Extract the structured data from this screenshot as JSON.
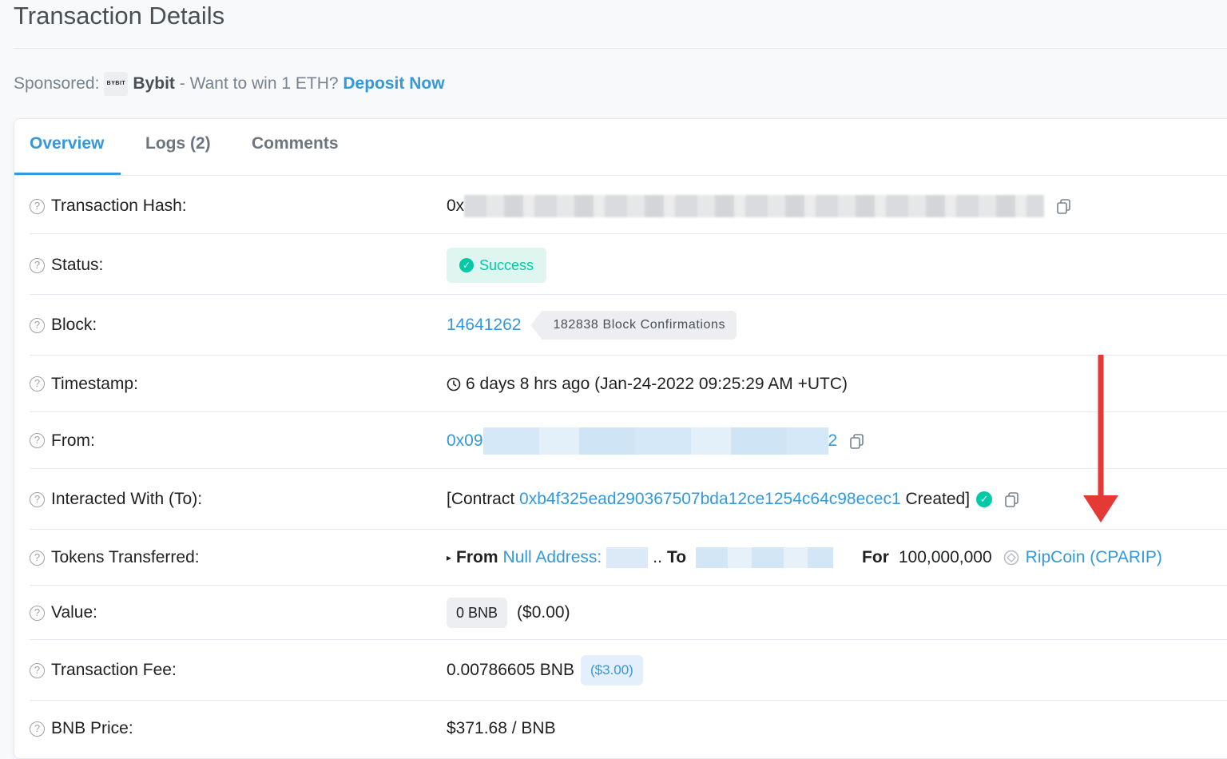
{
  "page": {
    "title": "Transaction Details"
  },
  "sponsored": {
    "label": "Sponsored:",
    "logo_text": "BYBIT",
    "brand": "Bybit",
    "text": " - Want to win 1 ETH? ",
    "link": "Deposit Now"
  },
  "tabs": [
    {
      "label": "Overview",
      "active": true
    },
    {
      "label": "Logs (2)",
      "active": false
    },
    {
      "label": "Comments",
      "active": false
    }
  ],
  "rows": {
    "hash": {
      "label": "Transaction Hash:",
      "prefix": "0x"
    },
    "status": {
      "label": "Status:",
      "value": "Success"
    },
    "block": {
      "label": "Block:",
      "number": "14641262",
      "confirmations": "182838 Block Confirmations"
    },
    "timestamp": {
      "label": "Timestamp:",
      "value": "6 days 8 hrs ago (Jan-24-2022 09:25:29 AM +UTC)"
    },
    "from": {
      "label": "From:",
      "prefix": "0x09",
      "suffix": "2"
    },
    "to": {
      "label": "Interacted With (To):",
      "before": "[Contract ",
      "address": "0xb4f325ead290367507bda12ce1254c64c98ecec1",
      "after": " Created]"
    },
    "tokens": {
      "label": "Tokens Transferred:",
      "bullet": "▸",
      "from_word": "From",
      "from_link": "Null Address:",
      "ellipsis": "..",
      "to_word": "To",
      "for_word": "For",
      "amount": "100,000,000",
      "token": "RipCoin (CPARIP)"
    },
    "value": {
      "label": "Value:",
      "amount": "0 BNB",
      "usd": "($0.00)"
    },
    "fee": {
      "label": "Transaction Fee:",
      "amount": "0.00786605 BNB",
      "usd": "($3.00)"
    },
    "price": {
      "label": "BNB Price:",
      "value": "$371.68 / BNB"
    }
  },
  "colors": {
    "accent": "#3498db",
    "success": "#00c9a7",
    "annotation_arrow": "#e53935"
  }
}
